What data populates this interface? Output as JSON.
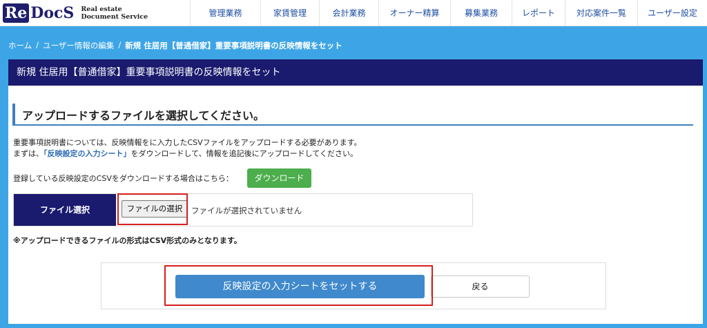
{
  "header": {
    "logo": {
      "mark_re": "Re",
      "mark_docs": "DocS",
      "sub_line1": "Real estate",
      "sub_line2": "Document Service"
    },
    "nav": [
      "管理業務",
      "家賃管理",
      "会計業務",
      "オーナー精算",
      "募集業務",
      "レポート",
      "対応案件一覧",
      "ユーザー設定"
    ]
  },
  "breadcrumb": {
    "home": "ホーム",
    "sep": "/",
    "parent": "ユーザー情報の編集",
    "current": "新規 住居用【普通借家】重要事項説明書の反映情報をセット"
  },
  "panel": {
    "title": "新規 住居用【普通借家】重要事項説明書の反映情報をセット",
    "section_heading": "アップロードするファイルを選択してください。",
    "line1": "重要事項説明書については、反映情報をに入力したCSVファイルをアップロードする必要があります。",
    "line2_prefix": "まずは、",
    "line2_link": "「反映設定の入力シート」",
    "line2_suffix": "をダウンロードして、情報を追記後にアップロードしてください。",
    "download_text": "登録している反映設定のCSVをダウンロードする場合はこちら：",
    "download_button": "ダウンロード",
    "file_label": "ファイル選択",
    "file_choose_button": "ファイルの選択",
    "file_status": "ファイルが選択されていません",
    "note": "※アップロードできるファイルの形式はCSV形式のみとなります。",
    "submit_button": "反映設定の入力シートをセットする",
    "back_button": "戻る"
  },
  "colors": {
    "background": "#3da5e6",
    "navy": "#1a1a6e",
    "accent_blue": "#3f89cc",
    "download_green": "#4cae4c",
    "highlight_red": "#d61e1e"
  }
}
